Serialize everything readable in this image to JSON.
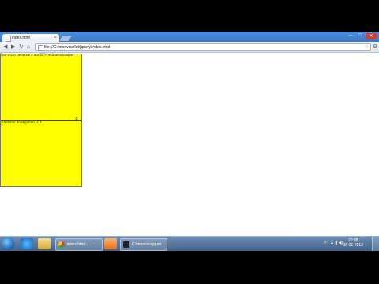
{
  "browser": {
    "tab_title": "index.html",
    "tab_close": "×",
    "url": "file:///C:/moovico/tut/jquery/index.html",
    "win_close": "✕",
    "win_min": "–",
    "win_max": "□"
  },
  "page": {
    "div1_text": "Este texto pertence a um DIV redimensionável",
    "div2_text": "Conteúdo do segundo DIV",
    "handle_glyph": "⇕"
  },
  "taskbar": {
    "btn1_label": "index.html - ...",
    "btn3_label": "C:\\moovico\\jquer...",
    "clock_time": "22:08",
    "clock_date": "08-01-2012",
    "tray_lang": "PT"
  },
  "colors": {
    "div_background": "#ffff00",
    "tab_strip": "#4f8fdc",
    "taskbar": "#42618a"
  }
}
